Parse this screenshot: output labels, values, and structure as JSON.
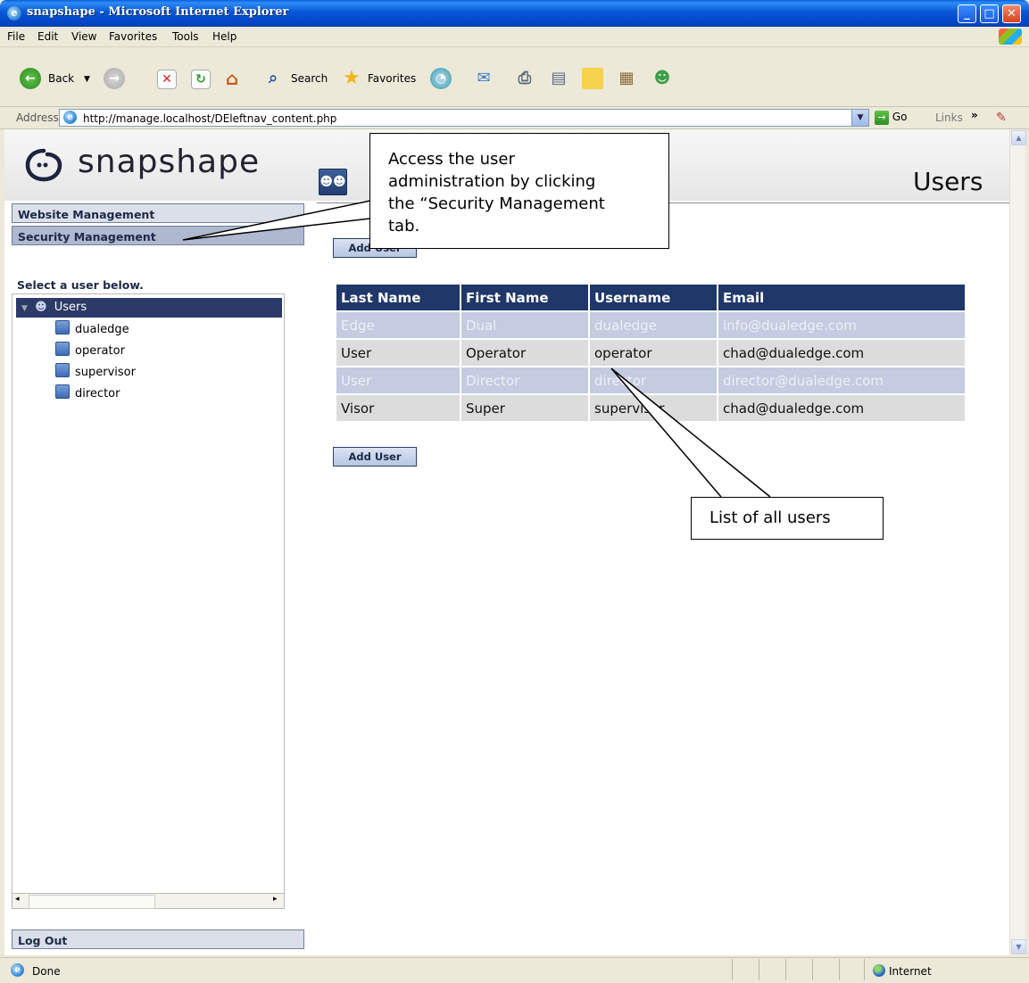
{
  "window": {
    "title": "snapshape - Microsoft Internet Explorer",
    "minimize": "_",
    "maximize": "□",
    "close": "✕"
  },
  "menu": [
    "File",
    "Edit",
    "View",
    "Favorites",
    "Tools",
    "Help"
  ],
  "toolbar": {
    "back_label": "Back",
    "search_label": "Search",
    "favorites_label": "Favorites"
  },
  "address": {
    "label": "Address",
    "url": "http://manage.localhost/DEleftnav_content.php",
    "go_label": "Go",
    "links_label": "Links"
  },
  "header": {
    "logo_text": "snapshape",
    "page_title": "Users"
  },
  "nav": {
    "tabs": [
      "Website Management",
      "Security Management"
    ],
    "active_tab": "Security Management",
    "select_label": "Select a user below.",
    "tree_root": "Users",
    "tree_items": [
      "dualedge",
      "operator",
      "supervisor",
      "director"
    ],
    "logout_label": "Log Out"
  },
  "main": {
    "add_user_label": "Add User",
    "columns": [
      "Last Name",
      "First Name",
      "Username",
      "Email"
    ],
    "rows": [
      [
        "Edge",
        "Dual",
        "dualedge",
        "info@dualedge.com"
      ],
      [
        "User",
        "Operator",
        "operator",
        "chad@dualedge.com"
      ],
      [
        "User",
        "Director",
        "director",
        "director@dualedge.com"
      ],
      [
        "Visor",
        "Super",
        "supervisor",
        "chad@dualedge.com"
      ]
    ]
  },
  "callouts": {
    "security_lines": [
      "Access the user",
      "administration by clicking",
      "the “Security Management",
      "tab."
    ],
    "users": "List of all users"
  },
  "status": {
    "text": "Done",
    "zone": "Internet"
  },
  "colors": {
    "table_header": "#1f3769",
    "row_odd": "#c5cbe0",
    "row_even": "#dcdcdc",
    "tree_selected": "#2b3a67"
  },
  "icons": [
    "ie-icon",
    "back-arrow-icon",
    "forward-arrow-icon",
    "stop-icon",
    "refresh-icon",
    "home-icon",
    "search-icon",
    "favorites-star-icon",
    "history-icon",
    "mail-icon",
    "print-icon",
    "edit-icon",
    "messenger-icon",
    "users-icon",
    "user-icon",
    "globe-icon"
  ]
}
